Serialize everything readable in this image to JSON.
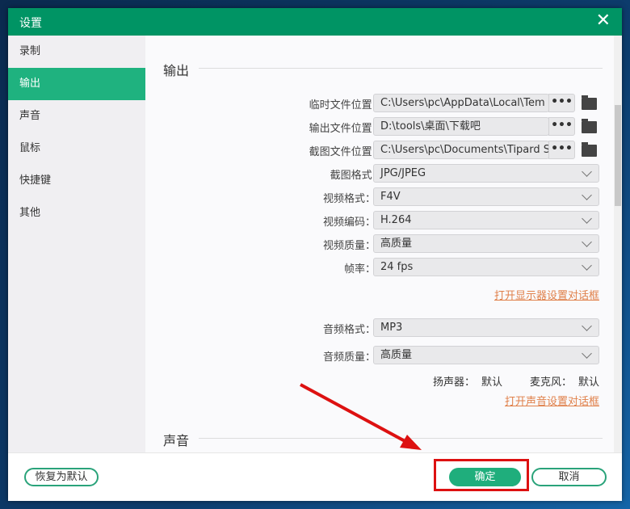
{
  "window": {
    "title": "设置",
    "close": "✕"
  },
  "sidebar": {
    "items": [
      {
        "label": "录制"
      },
      {
        "label": "输出",
        "active": true
      },
      {
        "label": "声音"
      },
      {
        "label": "鼠标"
      },
      {
        "label": "快捷键"
      },
      {
        "label": "其他"
      }
    ]
  },
  "output": {
    "section_title": "输出",
    "temp_label": "临时文件位置:",
    "temp_value": "C:\\Users\\pc\\AppData\\Local\\Tem",
    "out_label": "输出文件位置:",
    "out_value": "D:\\tools\\桌面\\下载吧",
    "shot_label": "截图文件位置:",
    "shot_value": "C:\\Users\\pc\\Documents\\Tipard S",
    "dots": "•••",
    "shot_format_label": "截图格式:",
    "shot_format": "JPG/JPEG",
    "video_format_label": "视频格式：",
    "video_format": "F4V",
    "video_codec_label": "视频编码：",
    "video_codec": "H.264",
    "video_quality_label": "视频质量：",
    "video_quality": "高质量",
    "fps_label": "帧率：",
    "fps": "24 fps",
    "display_link": "打开显示器设置对话框",
    "audio_format_label": "音频格式：",
    "audio_format": "MP3",
    "audio_quality_label": "音频质量：",
    "audio_quality": "高质量",
    "speaker_label": "扬声器：",
    "speaker_value": "默认",
    "mic_label": "麦克风：",
    "mic_value": "默认",
    "sound_link": "打开声音设置对话框"
  },
  "sound": {
    "section_title": "声音"
  },
  "footer": {
    "reset": "恢复为默认",
    "ok": "确定",
    "cancel": "取消"
  },
  "colors": {
    "title_bar": "#009464",
    "accent": "#1fae7c",
    "link": "#e0804a",
    "highlight_box": "#dd1111"
  }
}
